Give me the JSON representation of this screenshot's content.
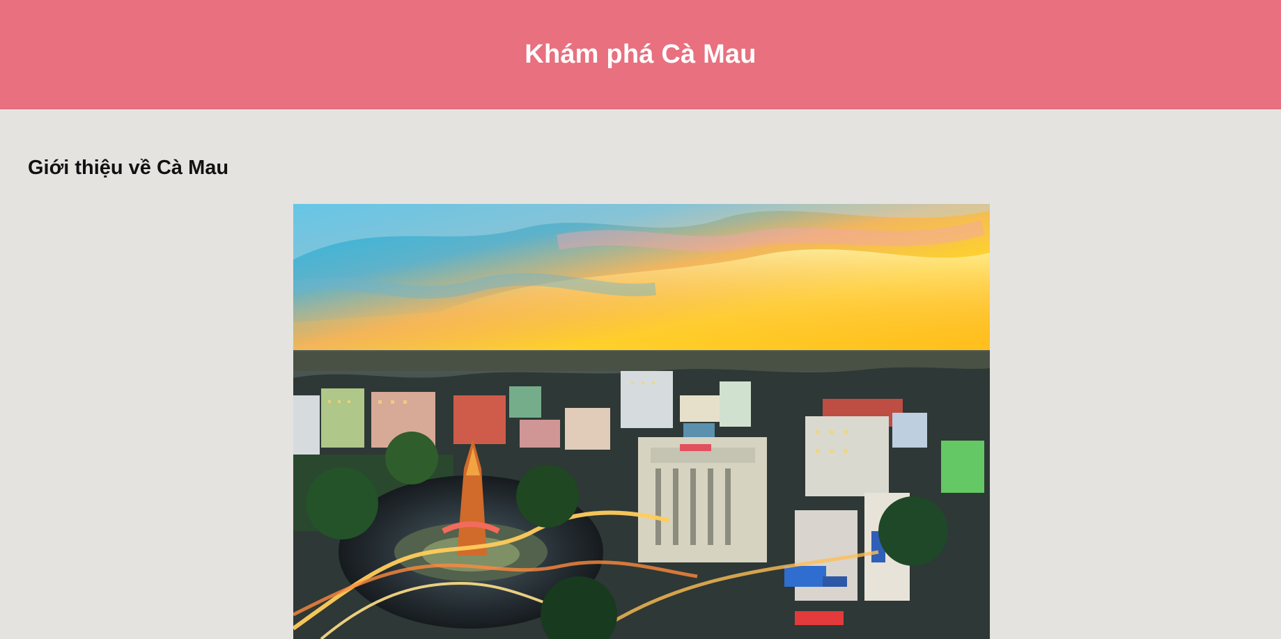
{
  "header": {
    "title": "Khám phá Cà Mau"
  },
  "main": {
    "section_title": "Giới thiệu về Cà Mau"
  },
  "colors": {
    "header_bg": "#e8707f",
    "page_bg": "#e4e3e0"
  },
  "image": {
    "subject": "aerial-city-sunset-photo"
  }
}
